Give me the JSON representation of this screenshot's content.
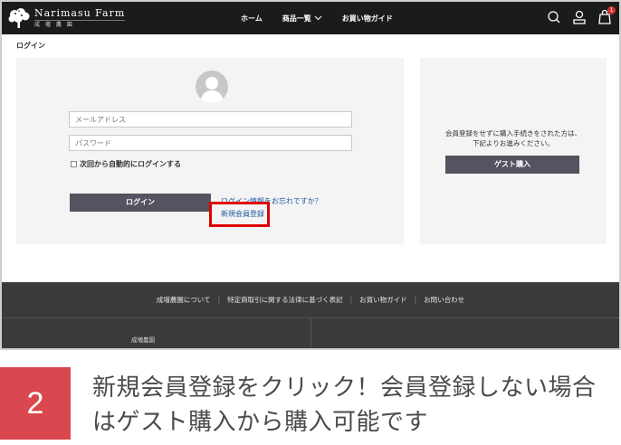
{
  "header": {
    "logo_main": "Narimasu Farm",
    "logo_sub": "成 増 農 園",
    "nav": [
      "ホーム",
      "商品一覧",
      "お買い物ガイド"
    ],
    "cart_count": "1",
    "icons": [
      "search-icon",
      "user-icon",
      "cart-icon",
      "tree-logo-icon",
      "chevron-down-icon"
    ]
  },
  "page": {
    "title": "ログイン"
  },
  "login": {
    "email_placeholder": "メールアドレス",
    "password_placeholder": "パスワード",
    "remember_label": "次回から自動的にログインする",
    "login_button": "ログイン",
    "forgot_link": "ログイン情報をお忘れですか？",
    "register_link": "新規会員登録"
  },
  "guest": {
    "message": "会員登録をせずに購入手続きをされた方は、下記よりお進みください。",
    "button": "ゲスト購入"
  },
  "footer": {
    "links": [
      "成増農園について",
      "特定商取引に関する法律に基づく表記",
      "お買い物ガイド",
      "お問い合わせ"
    ],
    "company": "成増農園"
  },
  "caption": {
    "step": "2",
    "text": "新規会員登録をクリック！会員登録しない場合はゲスト購入から購入可能です"
  },
  "colors": {
    "header_bg": "#1b1b1b",
    "button_bg": "#55535f",
    "link": "#1d5a9e",
    "highlight": "#e00000",
    "step_badge": "#d9474f",
    "footer_bg": "#3a3a3a"
  }
}
